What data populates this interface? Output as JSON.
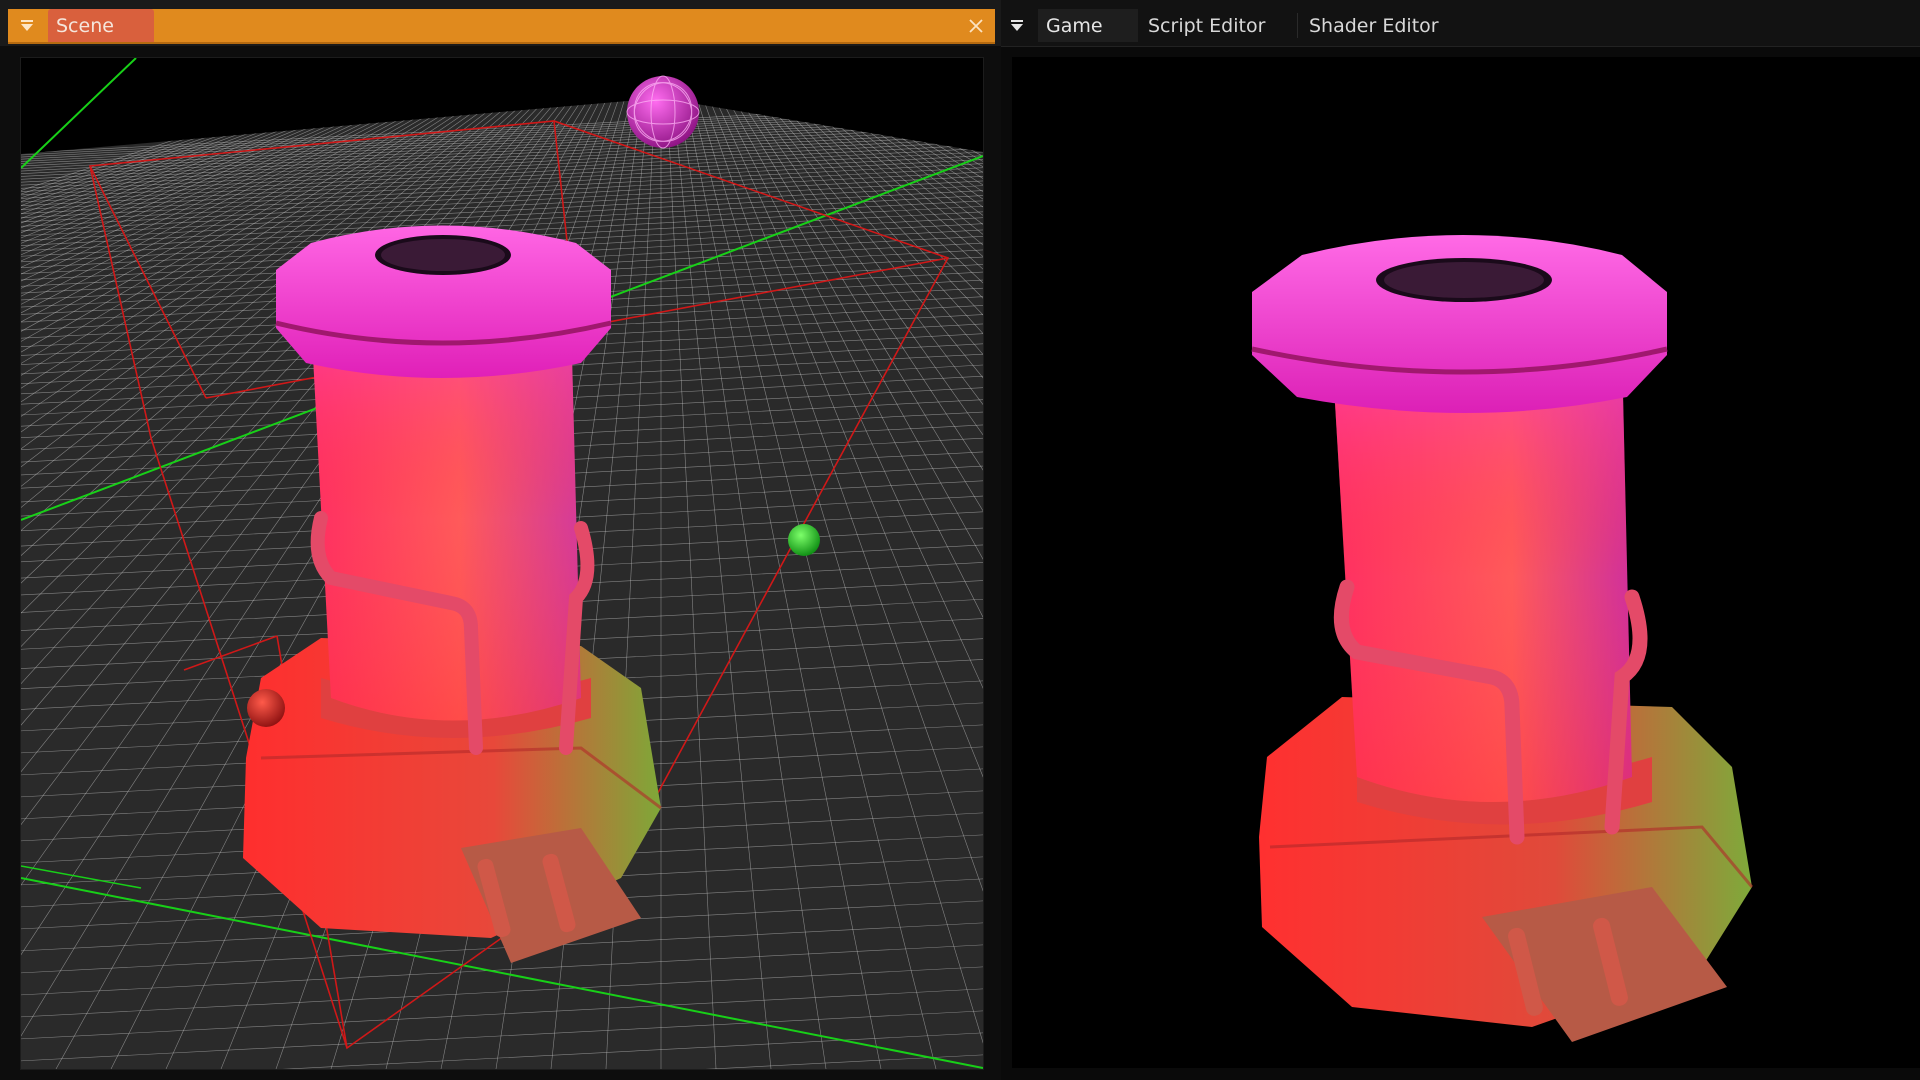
{
  "left_panel": {
    "tabs": [
      {
        "label": "Scene",
        "active": true
      }
    ],
    "close_icon": "close-icon",
    "menu_icon": "chevron-down-menu-icon"
  },
  "right_panel": {
    "menu_icon": "chevron-down-menu-icon",
    "tabs": [
      {
        "label": "Game",
        "active": true
      },
      {
        "label": "Script Editor",
        "active": false
      },
      {
        "label": "Shader Editor",
        "active": false
      }
    ]
  },
  "colors": {
    "header_accent": "#e08a1e",
    "active_tab": "#d9603d",
    "grid_line": "#cfcfcf",
    "axis_green": "#18d018",
    "bounds_red": "#d01818",
    "object_magenta": "#ff3fd0",
    "object_red": "#ff3a32",
    "object_green": "#7fc83a"
  }
}
